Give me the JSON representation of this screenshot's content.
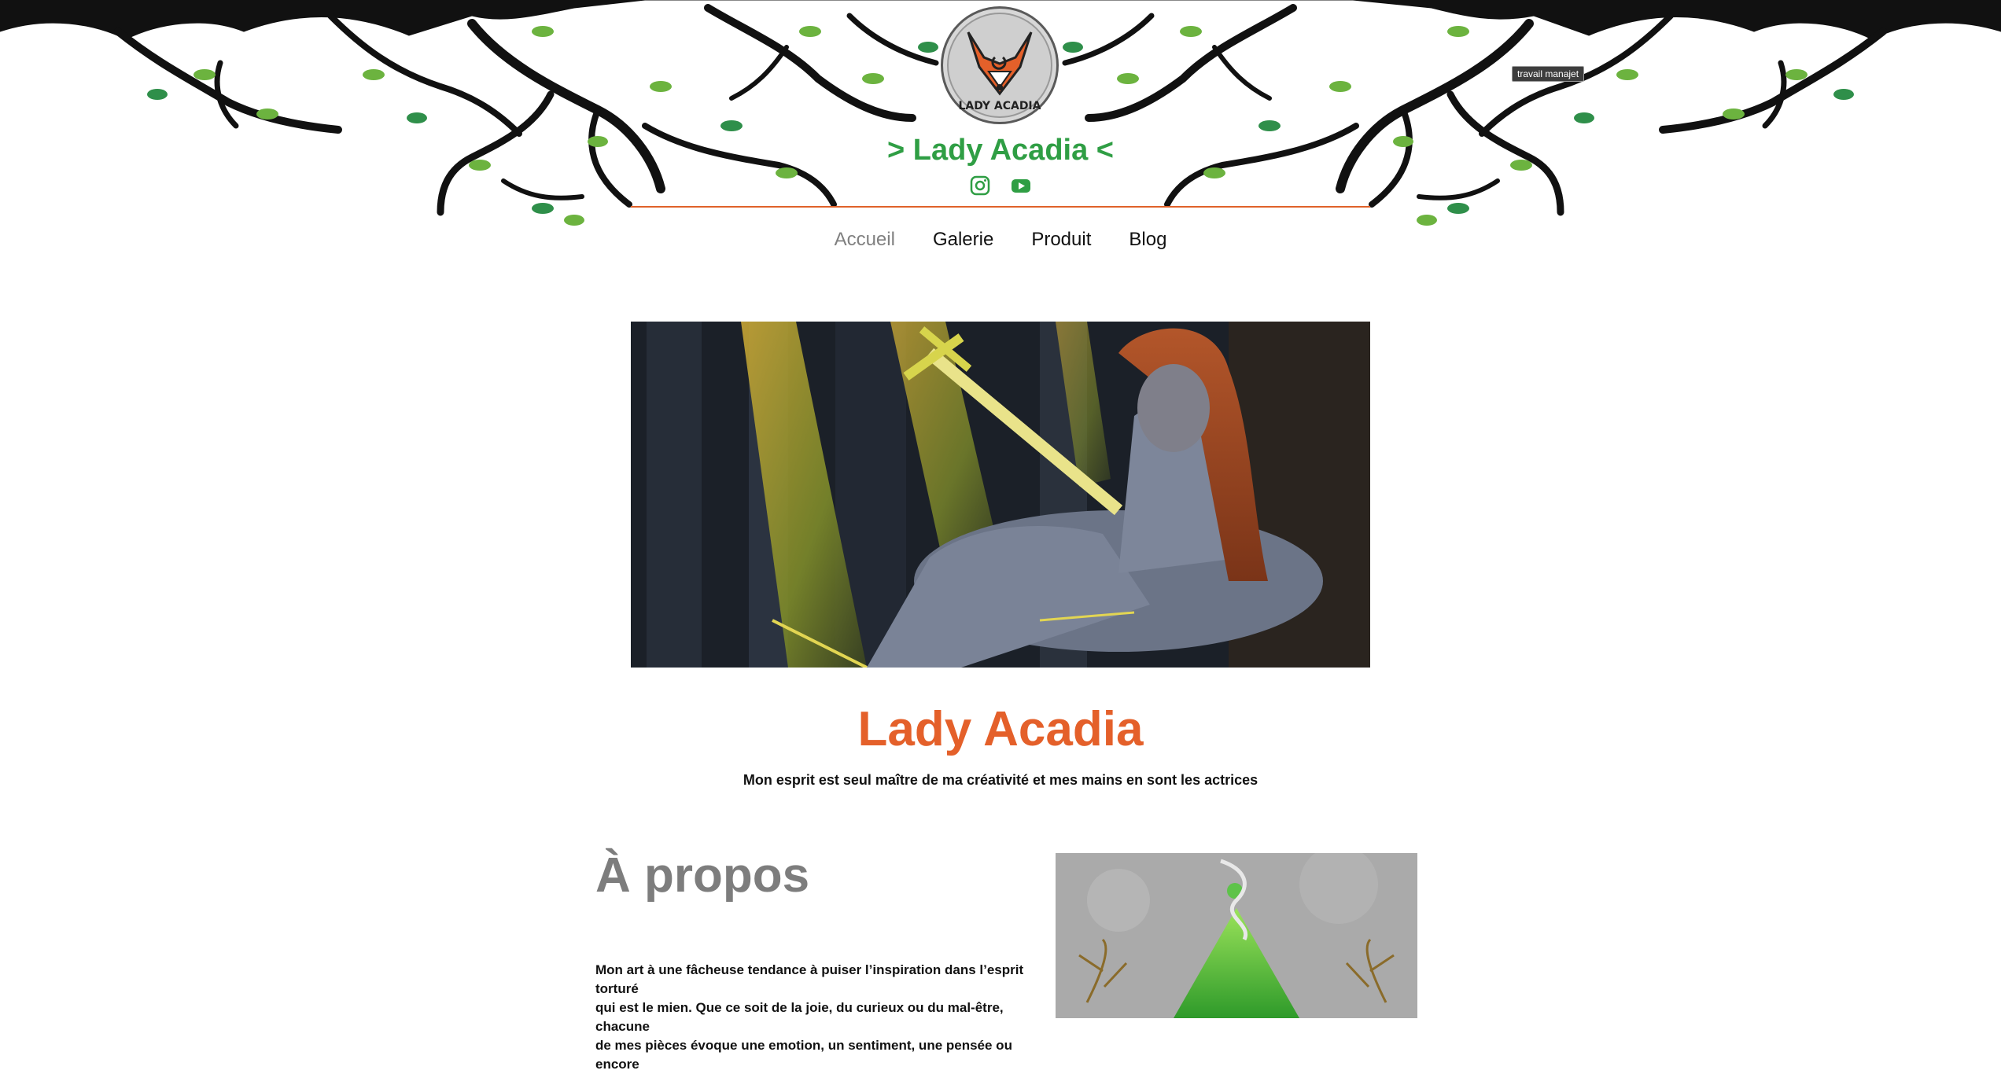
{
  "header": {
    "logo_alt": "LADY ACADIA",
    "site_title": "> Lady Acadia <",
    "socials": [
      {
        "name": "instagram-icon"
      },
      {
        "name": "youtube-icon"
      }
    ],
    "tooltip": "travail manajet",
    "colors": {
      "accent_green": "#2f9e44",
      "accent_orange": "#e4602a"
    }
  },
  "nav": {
    "items": [
      {
        "label": "Accueil",
        "active": true
      },
      {
        "label": "Galerie"
      },
      {
        "label": "Produit"
      },
      {
        "label": "Blog"
      }
    ]
  },
  "hero": {
    "title": "Lady Acadia",
    "tagline": "Mon esprit est seul maître de ma créativité et mes mains en sont les actrices"
  },
  "about": {
    "title": "À propos",
    "lines": [
      "Mon art à une fâcheuse tendance à puiser l’inspiration dans l’esprit torturé",
      "qui est le mien. Que ce soit de la joie, du curieux ou du mal-être, chacune",
      "de mes pièces évoque une emotion, un sentiment, une pensée ou encore"
    ]
  }
}
